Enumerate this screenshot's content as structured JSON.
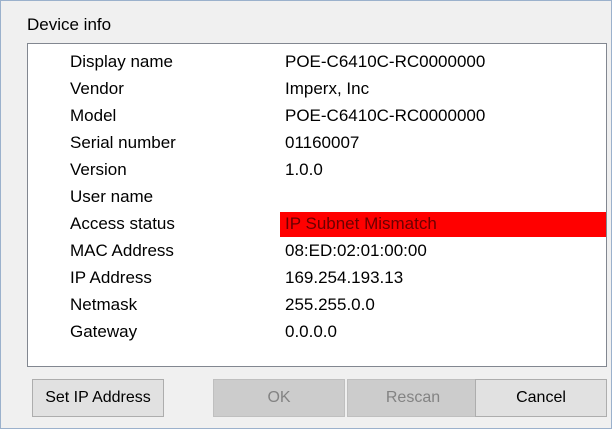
{
  "dialog": {
    "title": "Device info"
  },
  "info_rows": [
    {
      "label": "Display name",
      "value": "POE-C6410C-RC0000000"
    },
    {
      "label": "Vendor",
      "value": "Imperx, Inc"
    },
    {
      "label": "Model",
      "value": "POE-C6410C-RC0000000"
    },
    {
      "label": "Serial number",
      "value": "01160007"
    },
    {
      "label": "Version",
      "value": "1.0.0"
    },
    {
      "label": "User name",
      "value": ""
    },
    {
      "label": "Access status",
      "value": "IP Subnet Mismatch",
      "status_color": "#ff0000"
    },
    {
      "label": "MAC Address",
      "value": "08:ED:02:01:00:00"
    },
    {
      "label": "IP Address",
      "value": "169.254.193.13"
    },
    {
      "label": "Netmask",
      "value": "255.255.0.0"
    },
    {
      "label": "Gateway",
      "value": "0.0.0.0"
    }
  ],
  "buttons": {
    "set_ip": {
      "label": "Set IP Address",
      "enabled": true
    },
    "ok": {
      "label": "OK",
      "enabled": false
    },
    "rescan": {
      "label": "Rescan",
      "enabled": false
    },
    "cancel": {
      "label": "Cancel",
      "enabled": true
    }
  }
}
